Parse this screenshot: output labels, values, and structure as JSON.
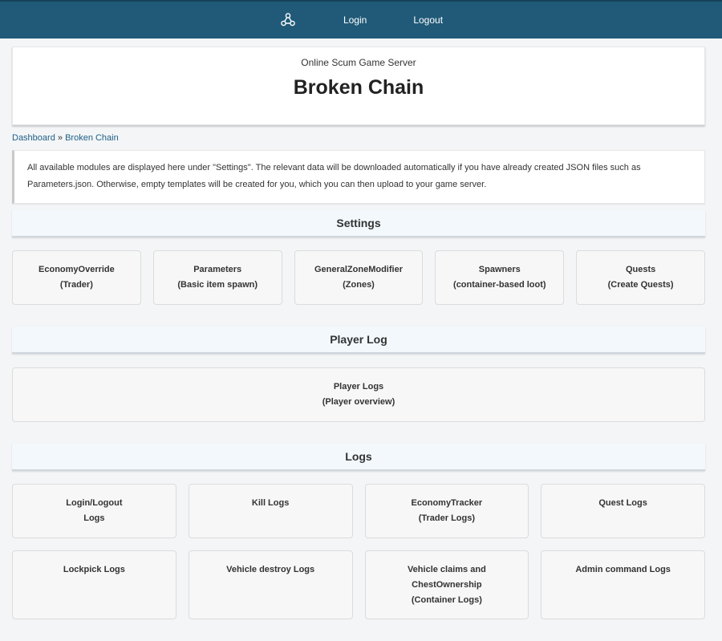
{
  "nav": {
    "logo_icon": "network-nodes-icon",
    "login_label": "Login",
    "logout_label": "Logout"
  },
  "header": {
    "subtitle": "Online Scum Game Server",
    "title": "Broken Chain"
  },
  "breadcrumb": {
    "home": "Dashboard",
    "separator": "»",
    "current": "Broken Chain"
  },
  "info": {
    "text": "All available modules are displayed here under \"Settings\". The relevant data will be downloaded automatically if you have already created JSON files such as Parameters.json. Otherwise, empty templates will be created for you, which you can then upload to your game server."
  },
  "settings": {
    "heading": "Settings",
    "cards": [
      {
        "line1": "EconomyOverride",
        "line2": "(Trader)"
      },
      {
        "line1": "Parameters",
        "line2": "(Basic item spawn)"
      },
      {
        "line1": "GeneralZoneModifier",
        "line2": "(Zones)"
      },
      {
        "line1": "Spawners",
        "line2": "(container-based loot)"
      },
      {
        "line1": "Quests",
        "line2": "(Create Quests)"
      }
    ]
  },
  "player_log": {
    "heading": "Player Log",
    "card": {
      "line1": "Player Logs",
      "line2": "(Player overview)"
    }
  },
  "logs": {
    "heading": "Logs",
    "row1": [
      {
        "line1": "Login/Logout",
        "line2": "Logs"
      },
      {
        "line1": "Kill Logs",
        "line2": ""
      },
      {
        "line1": "EconomyTracker",
        "line2": "(Trader Logs)"
      },
      {
        "line1": "Quest Logs",
        "line2": ""
      }
    ],
    "row2": [
      {
        "line1": "Lockpick Logs",
        "line2": "",
        "line3": ""
      },
      {
        "line1": "Vehicle destroy Logs",
        "line2": "",
        "line3": ""
      },
      {
        "line1": "Vehicle claims and",
        "line2": "ChestOwnership",
        "line3": "(Container Logs)"
      },
      {
        "line1": "Admin command Logs",
        "line2": "",
        "line3": ""
      }
    ]
  },
  "colors": {
    "topbar": "#205a78",
    "link": "#1f5f85",
    "section_bg": "#f3f8fc"
  }
}
